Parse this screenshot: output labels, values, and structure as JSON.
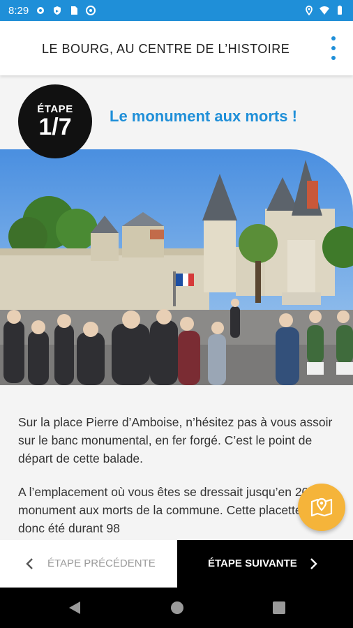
{
  "status_bar": {
    "time": "8:29",
    "icons_left": [
      "gear-icon",
      "shield-icon",
      "sim-card-icon",
      "at-sign-icon"
    ],
    "icons_right": [
      "location-icon",
      "wifi-icon",
      "battery-icon"
    ]
  },
  "app_bar": {
    "title": "LE BOURG, AU CENTRE DE L’HISTOIRE",
    "menu_icon": "more-vert-icon"
  },
  "stage": {
    "label": "ÉTAPE",
    "number": "1/7",
    "title": "Le monument aux morts !"
  },
  "photo": {
    "subject": "monument-square-photo"
  },
  "body": {
    "paragraph_1": "Sur la place Pierre d’Amboise, n’hésitez pas à vous assoir sur le banc monumental, en fer forgé. C’est le point de départ de cette balade.",
    "paragraph_2": "A l’emplacement où vous êtes se dressait jusqu’en 2019 le monument aux morts de la commune. Cette placette a donc été durant 98"
  },
  "fab": {
    "icon": "map-pin-icon"
  },
  "bottom_nav": {
    "prev_label": "ÉTAPE PRÉCÉDENTE",
    "next_label": "ÉTAPE SUIVANTE"
  },
  "colors": {
    "accent": "#1f8fd8",
    "fab": "#f5b43a",
    "badge": "#111111"
  }
}
